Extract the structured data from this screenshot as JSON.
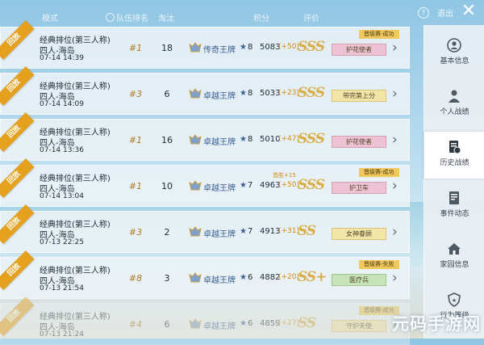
{
  "header": {
    "col_mode": "模式",
    "col_team_rank": "队伍排名",
    "col_kills": "淘汰",
    "col_score": "积分",
    "col_rating": "评价",
    "help": "?",
    "logout": "退出",
    "close": "✕"
  },
  "matches": [
    {
      "tag": "回放",
      "mode": "经典排位(第三人称)",
      "map": "四人-海岛",
      "time": "07-14 14:39",
      "rank": "#1",
      "kills": "18",
      "tier": "传奇王牌",
      "tier_level": "8",
      "score": "5083",
      "delta": "(+50)",
      "grade": "SSS",
      "badge": "护花使者",
      "badge_color": "pink",
      "season": "晋级赛-成功"
    },
    {
      "tag": "回放",
      "mode": "经典排位(第三人称)",
      "map": "四人-海岛",
      "time": "07-14 14:09",
      "rank": "#3",
      "kills": "6",
      "tier": "卓越王牌",
      "tier_level": "8",
      "score": "5033",
      "delta": "(+23)",
      "grade": "SSS",
      "badge": "带完第上分",
      "badge_color": "yellow"
    },
    {
      "tag": "回放",
      "mode": "经典排位(第三人称)",
      "map": "四人-海岛",
      "time": "07-14 13:36",
      "rank": "#1",
      "kills": "16",
      "tier": "卓越王牌",
      "tier_level": "8",
      "score": "5010",
      "delta": "(+47)",
      "grade": "SSS",
      "badge": "护花使者",
      "badge_color": "pink"
    },
    {
      "tag": "回放",
      "mode": "经典排位(第三人称)",
      "map": "四人-海岛",
      "time": "07-14 13:04",
      "rank": "#1",
      "kills": "10",
      "tier": "卓越王牌",
      "tier_level": "7",
      "score": "4963",
      "delta": "(+50)",
      "grade": "SSS",
      "badge": "护卫车",
      "badge_color": "pink",
      "season": "晋级赛-成功",
      "note": "首胜+15"
    },
    {
      "tag": "回放",
      "mode": "经典排位(第三人称)",
      "map": "四人-海岛",
      "time": "07-13 22:25",
      "rank": "#3",
      "kills": "2",
      "tier": "卓越王牌",
      "tier_level": "7",
      "score": "4913",
      "delta": "(+31)",
      "grade": "SS",
      "badge": "女神眷顾",
      "badge_color": "yellow"
    },
    {
      "tag": "回放",
      "mode": "经典排位(第三人称)",
      "map": "四人-海岛",
      "time": "07-13 21:54",
      "rank": "#8",
      "kills": "3",
      "tier": "卓越王牌",
      "tier_level": "6",
      "score": "4882",
      "delta": "(+20)",
      "grade": "SS+",
      "badge": "医疗兵",
      "badge_color": "green",
      "season": "晋级赛-失败"
    },
    {
      "tag": "回放",
      "mode": "经典排位(第三人称)",
      "map": "四人-海岛",
      "time": "07-13 21:24",
      "rank": "#4",
      "kills": "6",
      "tier": "卓越王牌",
      "tier_level": "6",
      "score": "4859",
      "delta": "(+27)",
      "grade": "SS",
      "badge": "守护天使",
      "badge_color": "yellow",
      "season": "晋级赛-成功"
    }
  ],
  "sidebar": [
    {
      "label": "基本信息",
      "icon": "user-badge-icon"
    },
    {
      "label": "个人战绩",
      "icon": "person-icon"
    },
    {
      "label": "历史战绩",
      "icon": "history-document-icon",
      "active": true
    },
    {
      "label": "事件动态",
      "icon": "event-document-icon"
    },
    {
      "label": "家园信息",
      "icon": "home-icon"
    },
    {
      "label": "行为等级",
      "icon": "shield-rating-icon"
    }
  ],
  "watermark": "元码手游网",
  "colors": {
    "accent_gold": "#e5a01d",
    "tier_blue": "#3c5f94",
    "score_delta": "#d48b13"
  }
}
